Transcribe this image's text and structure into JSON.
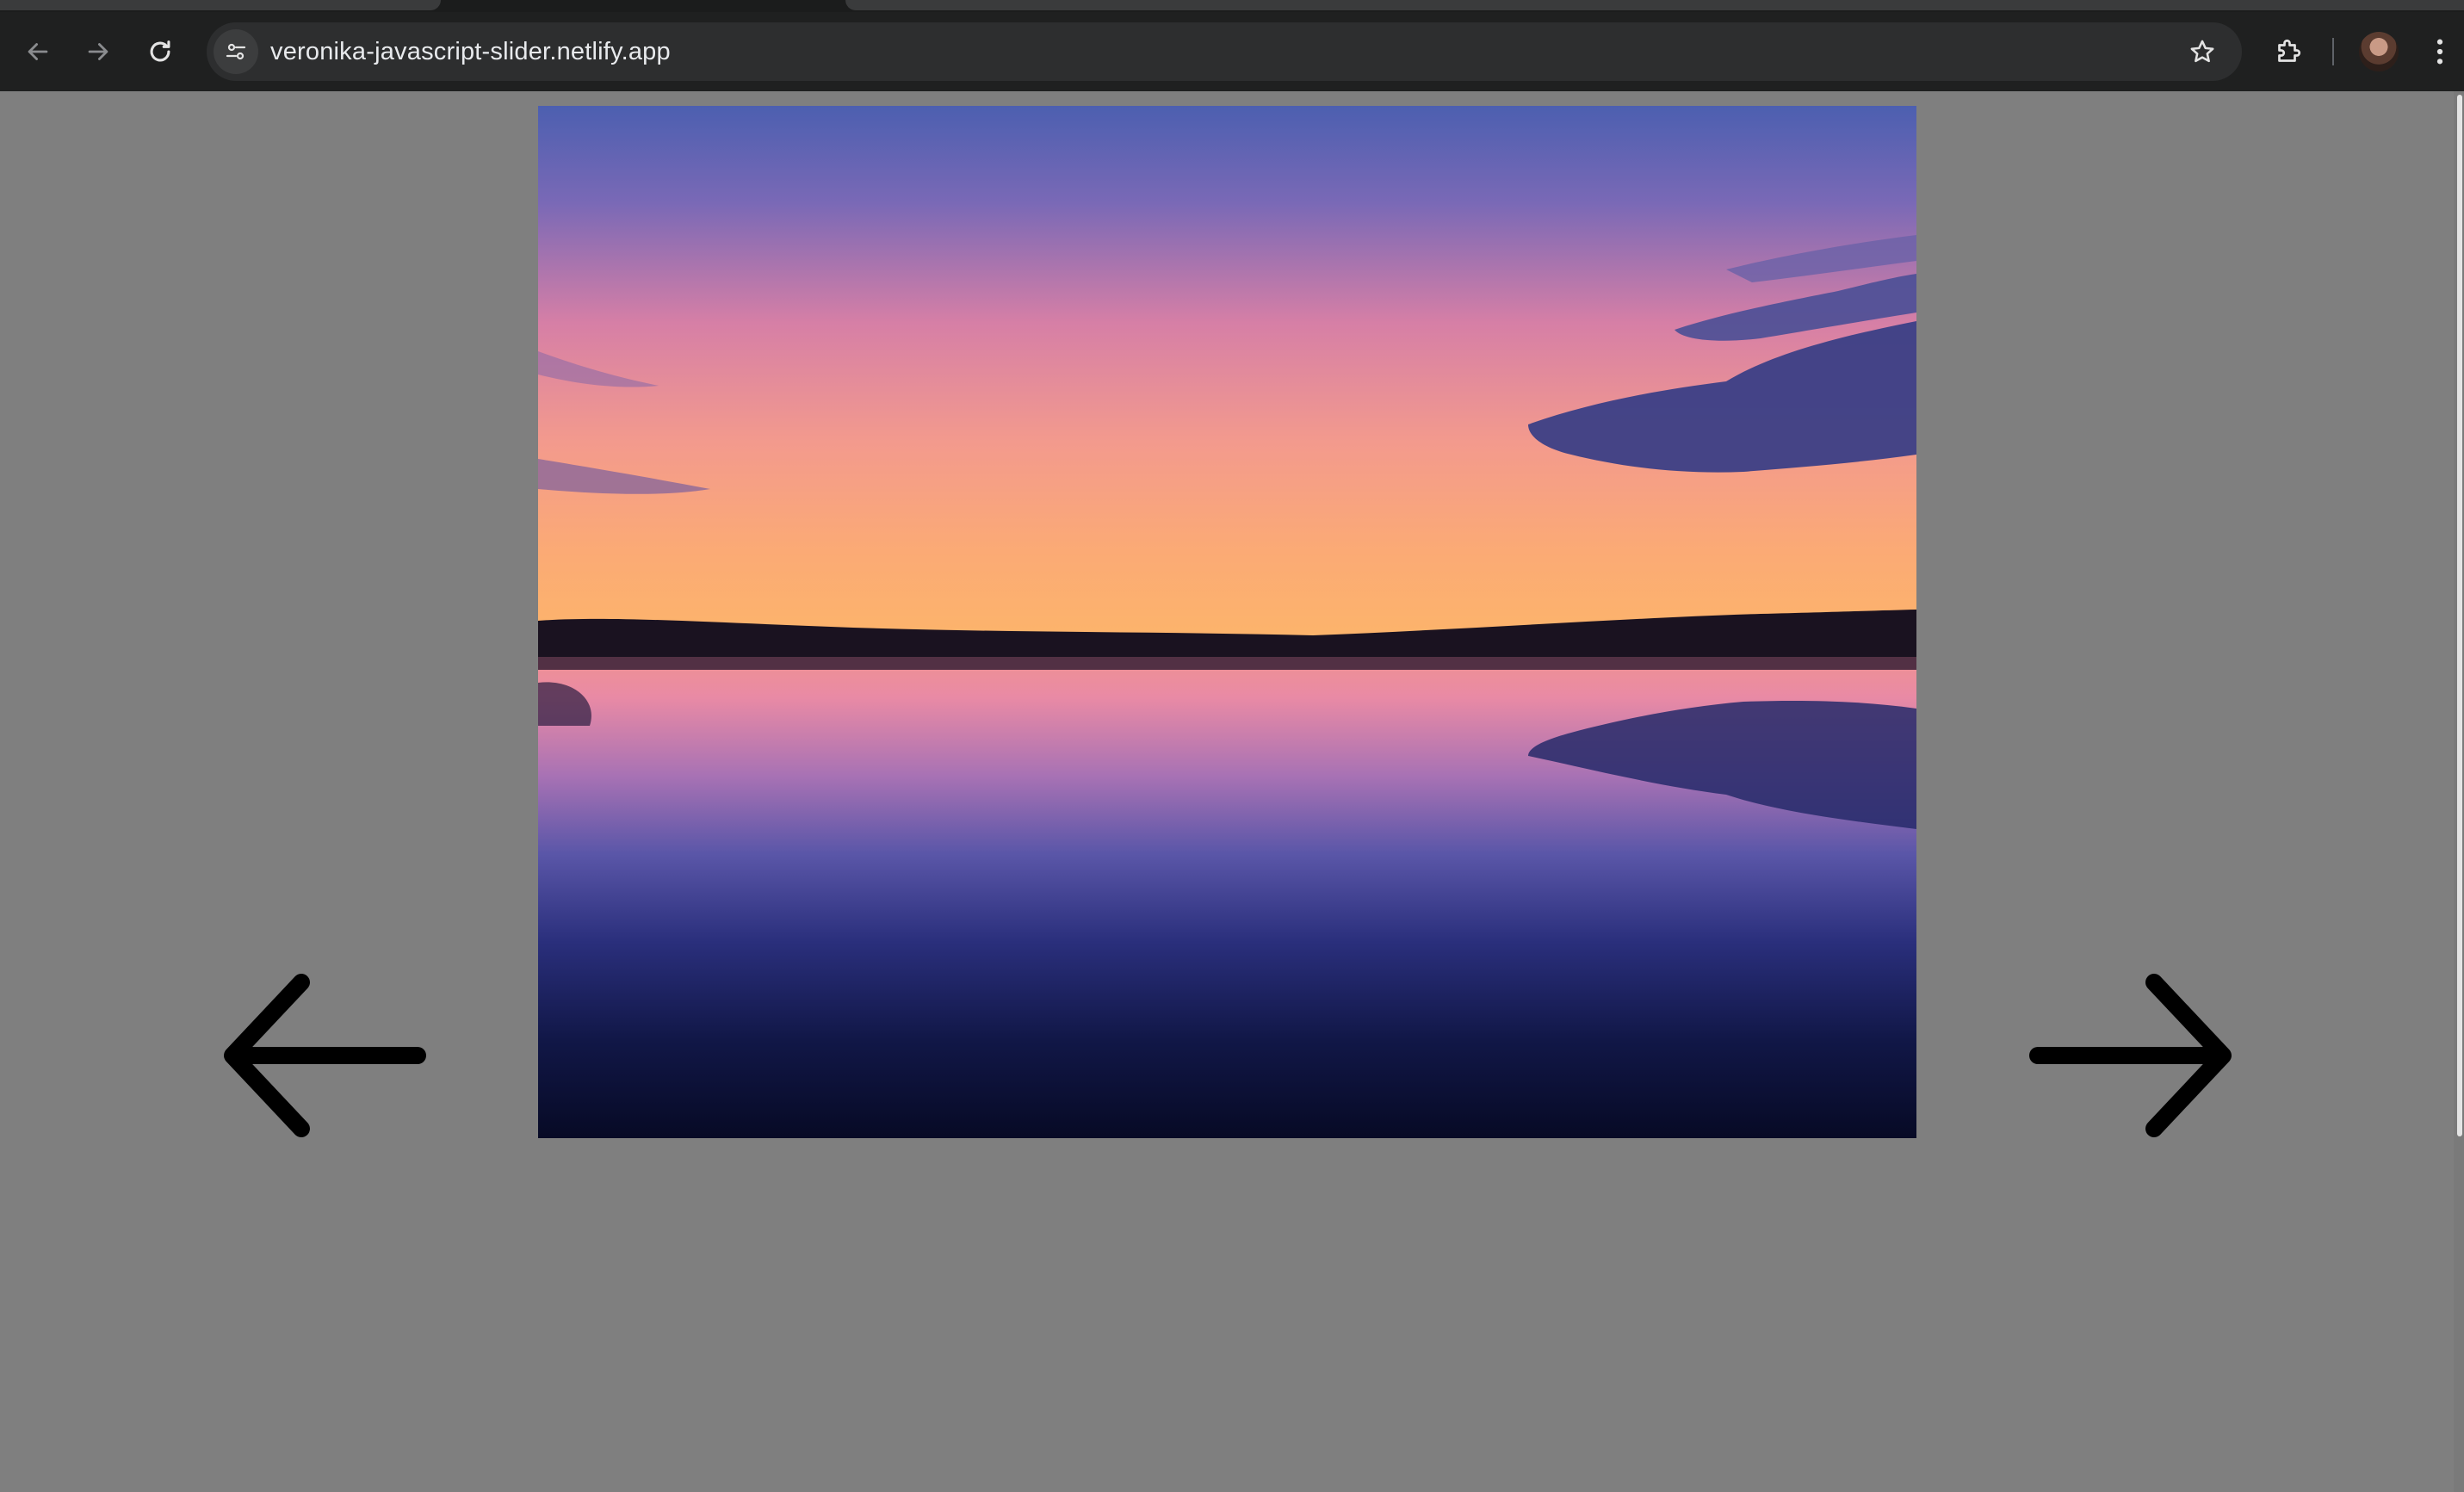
{
  "browser": {
    "url": "veronika-javascript-slider.netlify.app",
    "icons": {
      "back": "arrow-back-icon",
      "forward": "arrow-forward-icon",
      "reload": "reload-icon",
      "site_info": "tune-icon",
      "bookmark": "star-icon",
      "extensions": "puzzle-icon",
      "profile": "avatar",
      "menu": "more-vertical-icon"
    }
  },
  "page": {
    "background_color": "#7f7f7f",
    "slider": {
      "current_image": "sunset over lake with reflection",
      "prev_icon": "arrow-left-icon",
      "next_icon": "arrow-right-icon"
    }
  }
}
